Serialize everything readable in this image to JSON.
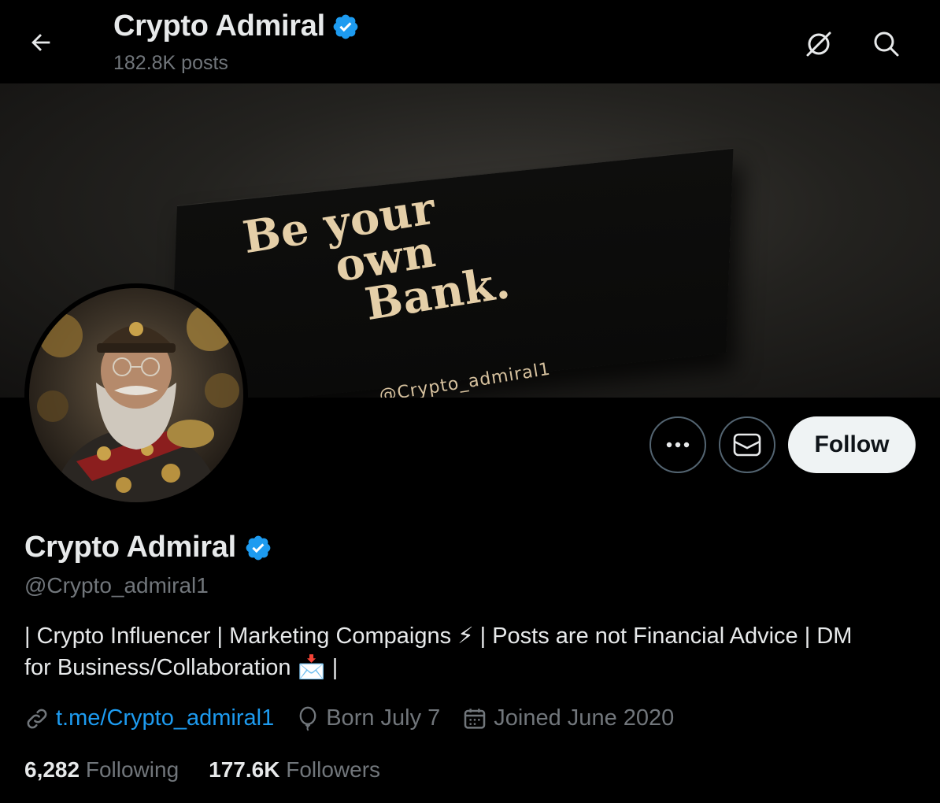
{
  "header": {
    "title": "Crypto Admiral",
    "posts_count": "182.8K posts"
  },
  "banner": {
    "line1": "Be your",
    "line2": "own",
    "line3": "Bank.",
    "handle": "@Crypto_admiral1"
  },
  "profile": {
    "display_name": "Crypto Admiral",
    "handle": "@Crypto_admiral1",
    "bio_line1": "| Crypto Influencer | Marketing Compaigns ⚡ | Posts are not Financial Advice | DM",
    "bio_line2": "for Business/Collaboration 📩 |",
    "link": "t.me/Crypto_admiral1",
    "birthday": "Born July 7",
    "joined": "Joined June 2020",
    "following_count": "6,282",
    "following_label": "Following",
    "followers_count": "177.6K",
    "followers_label": "Followers"
  },
  "actions": {
    "follow_label": "Follow"
  },
  "colors": {
    "accent": "#1d9bf0",
    "background": "#000000",
    "muted_text": "#71767b",
    "follow_bg": "#eff3f4"
  },
  "icons": [
    "back-arrow-icon",
    "grok-icon",
    "search-icon",
    "verified-badge-icon",
    "more-icon",
    "message-icon",
    "link-icon",
    "balloon-icon",
    "calendar-icon"
  ]
}
